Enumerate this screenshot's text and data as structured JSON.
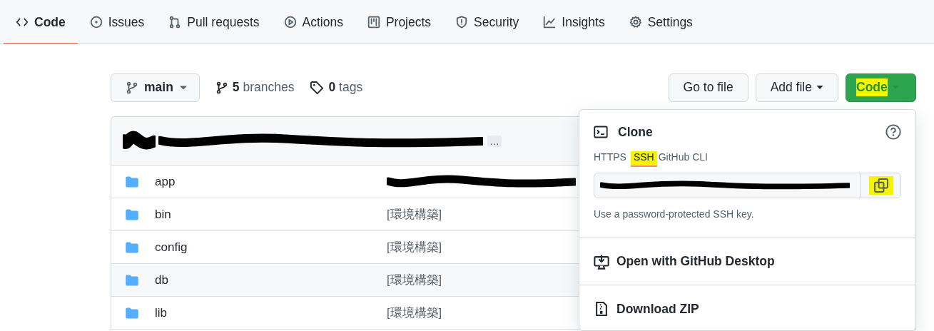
{
  "repo_tabs": [
    {
      "label": "Code",
      "selected": true
    },
    {
      "label": "Issues",
      "selected": false
    },
    {
      "label": "Pull requests",
      "selected": false
    },
    {
      "label": "Actions",
      "selected": false
    },
    {
      "label": "Projects",
      "selected": false
    },
    {
      "label": "Security",
      "selected": false
    },
    {
      "label": "Insights",
      "selected": false
    },
    {
      "label": "Settings",
      "selected": false
    }
  ],
  "branch_button": {
    "label": "main"
  },
  "branches": {
    "count": "5",
    "label": "branches"
  },
  "tags": {
    "count": "0",
    "label": "tags"
  },
  "actions": [
    {
      "label": "Go to file",
      "kind": "plain"
    },
    {
      "label": "Add file",
      "kind": "menu"
    },
    {
      "label": "Code",
      "kind": "primary",
      "highlighted": true
    }
  ],
  "latest_commit": {
    "redacted": true,
    "more": "…"
  },
  "files": [
    {
      "name": "app",
      "redacted": true,
      "hovered": false
    },
    {
      "name": "bin",
      "message": "[環境構築]",
      "redacted": false,
      "hovered": false
    },
    {
      "name": "config",
      "message": "[環境構築]",
      "redacted": false,
      "hovered": false
    },
    {
      "name": "db",
      "message": "[環境構築]",
      "redacted": false,
      "hovered": true
    },
    {
      "name": "lib",
      "message": "[環境構築]",
      "redacted": false,
      "hovered": false
    }
  ],
  "clone_menu": {
    "title": "Clone",
    "protocols": [
      {
        "label": "HTTPS",
        "selected": false,
        "highlighted": false
      },
      {
        "label": "SSH",
        "selected": true,
        "highlighted": true
      },
      {
        "label": "GitHub CLI",
        "selected": false,
        "highlighted": false
      }
    ],
    "url_redacted": true,
    "copy_highlighted": true,
    "note": "Use a password-protected SSH key.",
    "items": [
      {
        "label": "Open with GitHub Desktop"
      },
      {
        "label": "Download ZIP"
      }
    ]
  }
}
